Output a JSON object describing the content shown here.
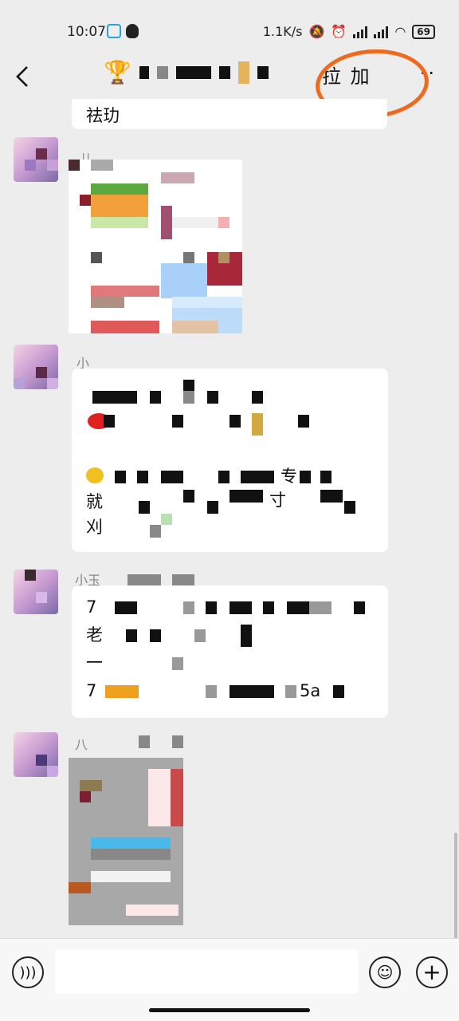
{
  "status_bar": {
    "time": "10:07",
    "net_speed": "1.1K/s",
    "battery": "69"
  },
  "nav": {
    "right_text": "拉 加"
  },
  "messages": [
    {
      "partial_text": "祛玏"
    },
    {
      "nick": "儿"
    },
    {
      "nick": "小"
    },
    {
      "nick": "小玉",
      "lines": [
        "7",
        "老",
        "一",
        "7"
      ],
      "tail_text": "5a"
    },
    {
      "nick": "八"
    }
  ],
  "chat_text": {
    "m3_line4": "专",
    "m3_line5_a": "就",
    "m3_line5_b": "寸",
    "m3_line6": "刈"
  },
  "colors": {
    "background": "#ededed",
    "annotation": "#f06a1e"
  },
  "icons": {
    "back": "back-arrow-icon",
    "voice": "voice-icon",
    "emoji": "emoji-icon",
    "plus": "plus-icon",
    "more": "more-icon"
  }
}
